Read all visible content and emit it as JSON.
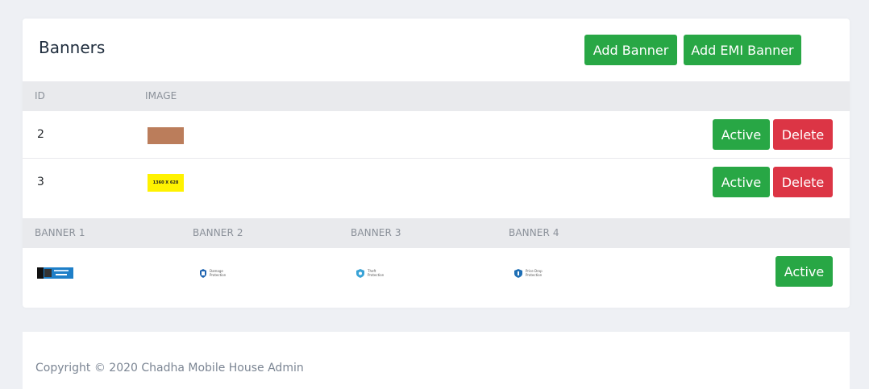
{
  "card": {
    "title": "Banners",
    "add_banner_label": "Add Banner",
    "add_emi_banner_label": "Add EMI Banner"
  },
  "banners_table": {
    "headers": [
      "ID",
      "IMAGE"
    ],
    "rows": [
      {
        "id": "2",
        "active_label": "Active",
        "delete_label": "Delete"
      },
      {
        "id": "3",
        "image_text": "1360 X 628",
        "active_label": "Active",
        "delete_label": "Delete"
      }
    ]
  },
  "emi_table": {
    "headers": [
      "BANNER 1",
      "BANNER 2",
      "BANNER 3",
      "BANNER 4"
    ],
    "thumbs": {
      "banner2": "Damage Protection",
      "banner3": "Theft Protection",
      "banner4": "Price Drop Protection"
    },
    "active_label": "Active"
  },
  "footer": {
    "text": "Copyright © 2020 Chadha Mobile House Admin"
  },
  "colors": {
    "success": "#28a745",
    "danger": "#dc3545",
    "header_bg": "#e9eaed"
  }
}
